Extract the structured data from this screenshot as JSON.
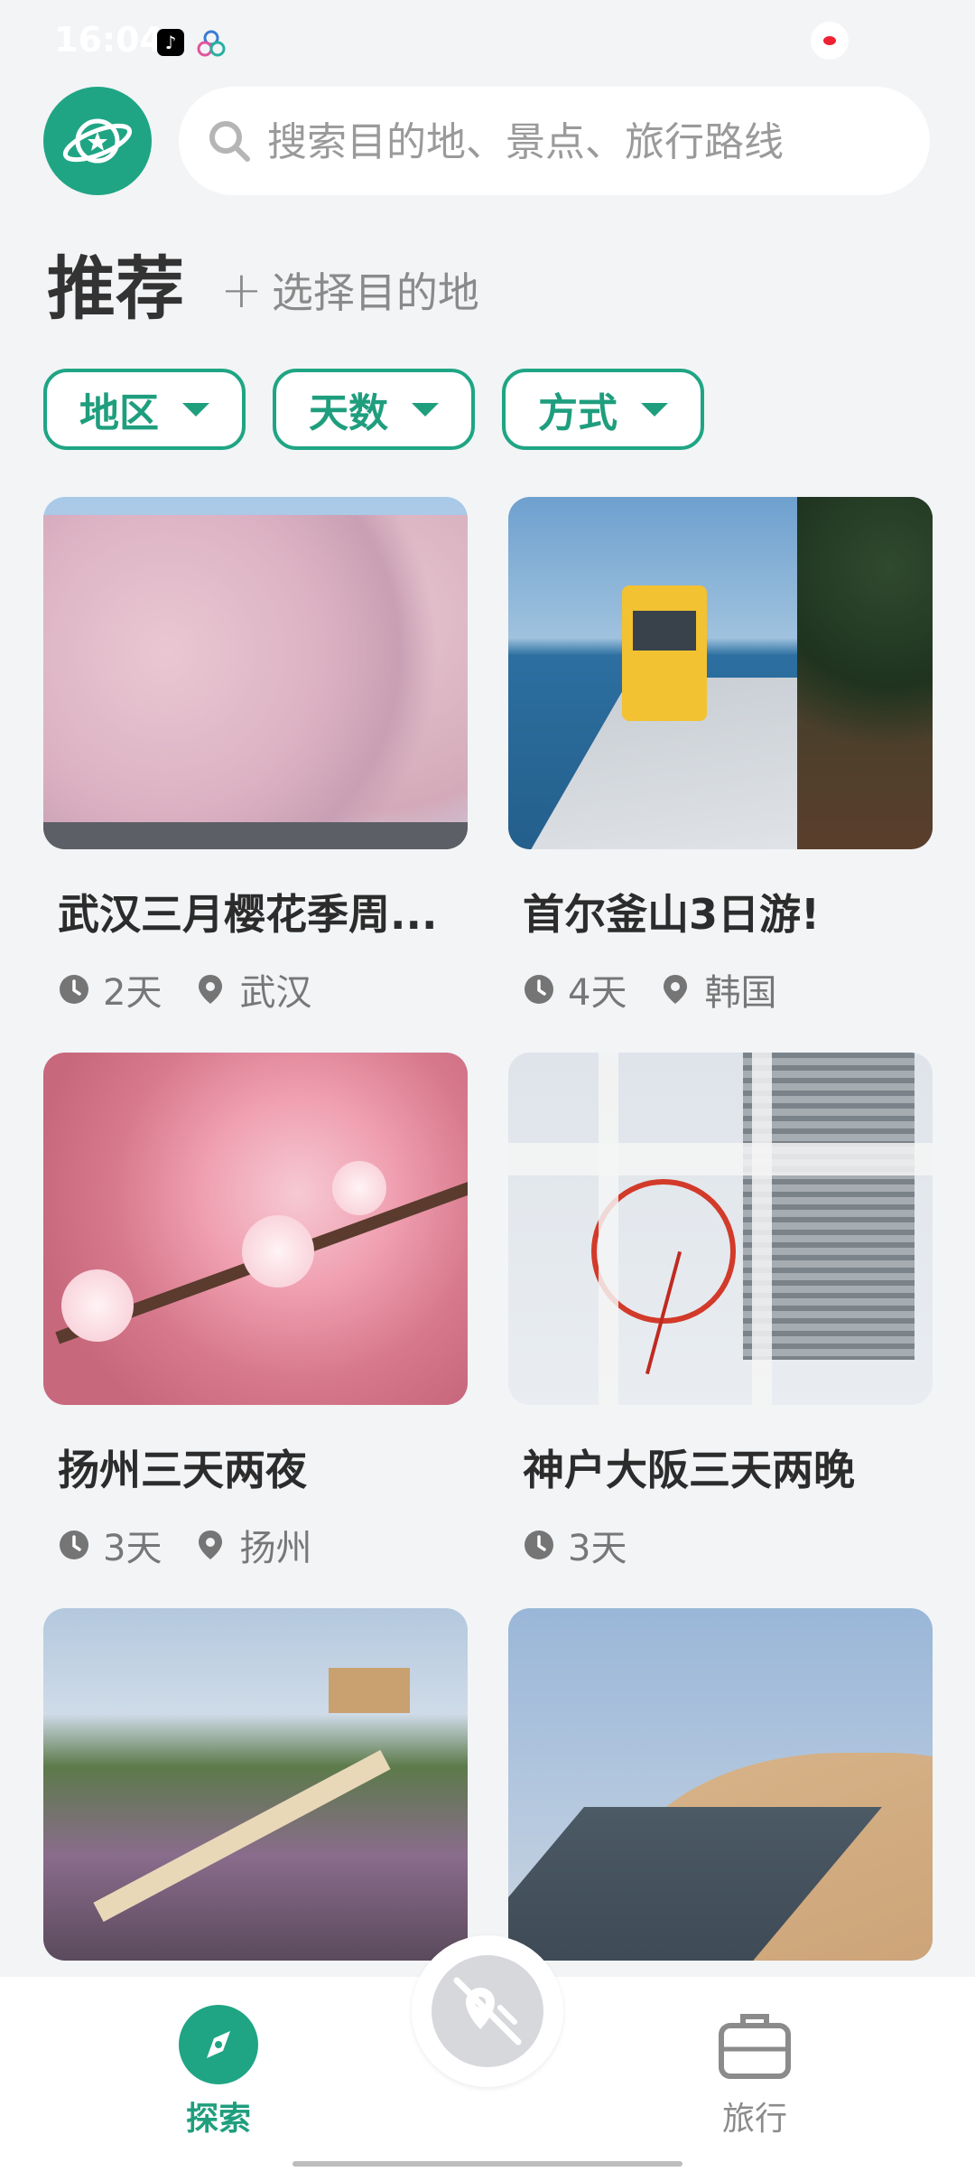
{
  "status_bar": {
    "time": "16:04"
  },
  "search": {
    "placeholder": "搜索目的地、景点、旅行路线"
  },
  "header": {
    "title": "推荐",
    "choose_destination": "选择目的地"
  },
  "filters": [
    {
      "label": "地区"
    },
    {
      "label": "天数"
    },
    {
      "label": "方式"
    }
  ],
  "cards": [
    {
      "title": "武汉三月樱花季周...",
      "days": "2天",
      "location": "武汉"
    },
    {
      "title": "首尔釜山3日游!",
      "days": "4天",
      "location": "韩国"
    },
    {
      "title": "扬州三天两夜",
      "days": "3天",
      "location": "扬州"
    },
    {
      "title": "神户大阪三天两晚",
      "days": "3天",
      "location": ""
    },
    {
      "title": "",
      "days": "",
      "location": ""
    },
    {
      "title": "",
      "days": "",
      "location": ""
    }
  ],
  "bottom_nav": {
    "explore_label": "探索",
    "trip_label": "旅行"
  },
  "colors": {
    "accent": "#1fa584",
    "background": "#f2f4f6"
  },
  "icons": [
    "search-icon",
    "planet-logo-icon",
    "clock-icon",
    "location-pin-icon",
    "compass-icon",
    "map-off-icon",
    "suitcase-icon"
  ]
}
